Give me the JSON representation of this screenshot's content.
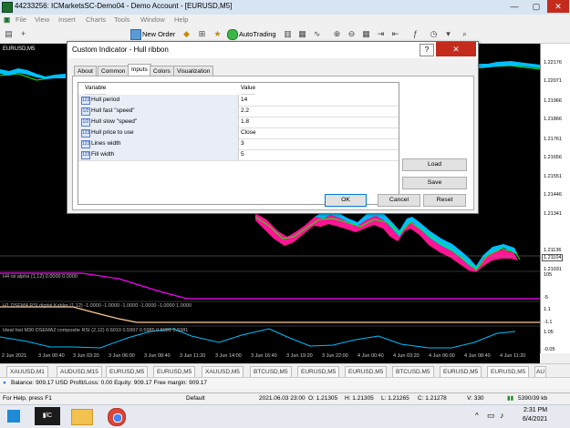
{
  "window": {
    "title": "44233256: ICMarketsSC-Demo04 - Demo Account - [EURUSD,M5]",
    "minimize": "—",
    "maximize": "▢",
    "close": "✕"
  },
  "menu": [
    "File",
    "View",
    "Insert",
    "Charts",
    "Tools",
    "Window",
    "Help"
  ],
  "toolbar": {
    "new_order": "New Order",
    "autotrading": "AutoTrading"
  },
  "chart": {
    "symbol_label": "EURUSD,M5",
    "price_ticks": [
      "1.22176",
      "1.22071",
      "1.21966",
      "1.21866",
      "1.21761",
      "1.21656",
      "1.21551",
      "1.21446",
      "1.21341",
      "1.21136",
      "1.21104",
      "1.21031"
    ],
    "current_price": "1.21104",
    "indicator_labels": [
      "H4 rsi alpha (1,12) 0.0000 0.0000",
      "H1 DSEMA RSI digital Kahler (1,12) -1.0000 -1.0000 -1.0000 -1.0000 -1.0000 1.0000",
      "Ideal hist M30 DSEMA2 composite RSI (2,12) 0.6010 0.5997 0.5985 0.5981 0.5981"
    ],
    "sub_axis_ticks": [
      "105",
      "-5",
      "1.1",
      "-1.1",
      "1.05",
      "-0.05"
    ],
    "time_ticks": [
      "2 Jun 2021",
      "3 Jun 00:40",
      "3 Jun 03:20",
      "3 Jun 06:00",
      "3 Jun 08:40",
      "3 Jun 11:20",
      "3 Jun 14:00",
      "3 Jun 16:40",
      "3 Jun 19:20",
      "3 Jun 22:00",
      "4 Jun 00:40",
      "4 Jun 03:20",
      "4 Jun 06:00",
      "4 Jun 08:40",
      "4 Jun 11:20"
    ],
    "colors": {
      "ribbon_up": "#00bfff",
      "ribbon_down": "#ff1493",
      "indicator_line": "#ff00ff",
      "price_bars": "#00ff00"
    }
  },
  "symbol_tabs": [
    "XAUUSD,M1",
    "AUDUSD,M15",
    "EURUSD,M5",
    "EURUSD,M5",
    "XAUUSD,M5",
    "BTCUSD,M5",
    "EURUSD,M5",
    "EURUSD,M5",
    "BTCUSD,M5",
    "EURUSD,M5",
    "EURUSD,M5",
    "BTCUSD,M5",
    "AU"
  ],
  "terminal": "Balance: 909.17 USD  Profit/Loss: 0.00  Equity: 909.17  Free margin: 909.17",
  "status": {
    "help": "For Help, press F1",
    "profile": "Default",
    "datetime": "2021.06.03 23:00",
    "open": "O: 1.21305",
    "high": "H: 1.21305",
    "low": "L: 1.21265",
    "close": "C: 1.21278",
    "volume": "V: 330",
    "traffic": "5390/39 kb"
  },
  "taskbar": {
    "time": "2:31 PM",
    "date": "6/4/2021"
  },
  "dialog": {
    "title": "Custom Indicator - Hull ribbon",
    "help": "?",
    "close": "✕",
    "tabs": [
      "About",
      "Common",
      "Inputs",
      "Colors",
      "Visualization"
    ],
    "active_tab": "Inputs",
    "grid_headers": {
      "variable": "Variable",
      "value": "Value"
    },
    "rows": [
      {
        "icon": "123",
        "variable": "Hull period",
        "value": "14"
      },
      {
        "icon": "1/2",
        "variable": "Hull fast \"speed\"",
        "value": "2.2"
      },
      {
        "icon": "1/2",
        "variable": "Hull slow \"speed\"",
        "value": "1.8"
      },
      {
        "icon": "123",
        "variable": "Hull price to use",
        "value": "Close"
      },
      {
        "icon": "123",
        "variable": "Lines width",
        "value": "3"
      },
      {
        "icon": "123",
        "variable": "Fill width",
        "value": "5"
      }
    ],
    "buttons": {
      "load": "Load",
      "save": "Save",
      "ok": "OK",
      "cancel": "Cancel",
      "reset": "Reset"
    }
  }
}
